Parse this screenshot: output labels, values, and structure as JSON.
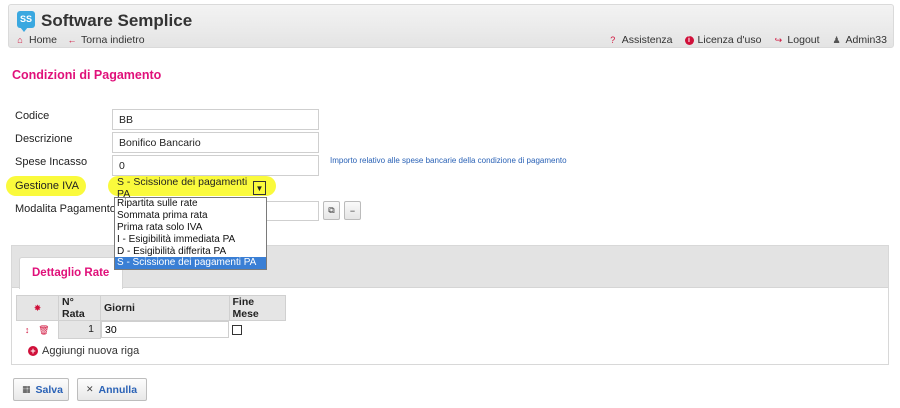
{
  "header": {
    "app_title": "Software Semplice",
    "logo_text": "SS",
    "nav_left": [
      {
        "label": "Home"
      },
      {
        "label": "Torna indietro"
      }
    ],
    "nav_right": [
      {
        "label": "Assistenza"
      },
      {
        "label": "Licenza d'uso"
      },
      {
        "label": "Logout"
      },
      {
        "label": "Admin33"
      }
    ]
  },
  "page_title": "Condizioni di Pagamento",
  "form": {
    "codice": {
      "label": "Codice",
      "value": "BB"
    },
    "descrizione": {
      "label": "Descrizione",
      "value": "Bonifico Bancario"
    },
    "spese_incasso": {
      "label": "Spese Incasso",
      "value": "0",
      "hint": "Importo relativo alle spese bancarie della condizione di pagamento"
    },
    "gestione_iva": {
      "label": "Gestione IVA",
      "selected": "S - Scissione dei pagamenti PA",
      "options": [
        "Ripartita sulle rate",
        "Sommata prima rata",
        "Prima rata solo IVA",
        "I - Esigibilità immediata PA",
        "D - Esigibilità differita PA",
        "S - Scissione dei pagamenti PA"
      ]
    },
    "modalita_pagamento": {
      "label": "Modalita Pagamento",
      "value": ""
    }
  },
  "dettaglio": {
    "tab_label": "Dettaglio Rate",
    "columns": {
      "rata": "N° Rata",
      "giorni": "Giorni",
      "fine_mese": "Fine Mese"
    },
    "rows": [
      {
        "rata": "1",
        "giorni": "30",
        "fine_mese": false
      }
    ],
    "add_row_label": "Aggiungi nuova riga"
  },
  "footer": {
    "save_label": "Salva",
    "cancel_label": "Annulla"
  },
  "colors": {
    "accent": "#e0107a",
    "link": "#2a62b6",
    "highlight": "#fafa3c",
    "selected_option": "#3a7fd5"
  }
}
